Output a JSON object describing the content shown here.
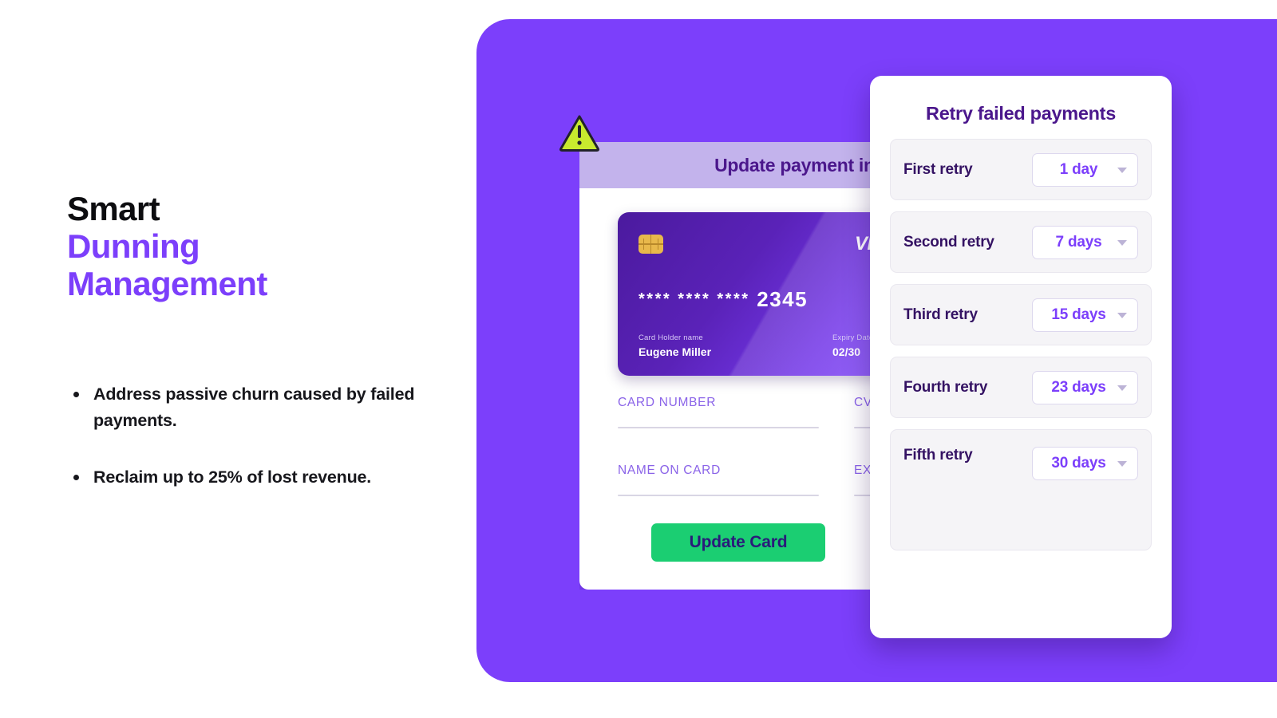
{
  "headline": {
    "line1": "Smart",
    "line2": "Dunning",
    "line3": "Management"
  },
  "bullets": [
    "Address passive churn caused by failed payments.",
    "Reclaim up to 25% of lost revenue."
  ],
  "payment_modal": {
    "title": "Update payment info",
    "warning_icon": "warning-triangle-icon",
    "credit_card": {
      "chip_icon": "chip-icon",
      "brand": "VISA",
      "masked_groups": "**** **** ****",
      "last_four": "2345",
      "holder_label": "Card Holder name",
      "holder_name": "Eugene Miller",
      "expiry_label": "Expiry Date",
      "expiry_value": "02/30"
    },
    "fields": {
      "card_number_label": "CARD NUMBER",
      "cvc_label": "CVC",
      "name_on_card_label": "NAME ON CARD",
      "exp_date_label": "EXP DATE"
    },
    "submit_label": "Update Card"
  },
  "retry_panel": {
    "title": "Retry failed payments",
    "rows": [
      {
        "label": "First retry",
        "value": "1 day"
      },
      {
        "label": "Second retry",
        "value": "7 days"
      },
      {
        "label": "Third retry",
        "value": "15 days"
      },
      {
        "label": "Fourth retry",
        "value": "23 days"
      },
      {
        "label": "Fifth retry",
        "value": "30 days"
      }
    ]
  },
  "colors": {
    "accent_purple": "#7C3FFB",
    "deep_purple": "#4B178C",
    "header_lavender": "#C3B3EC",
    "success_green": "#1BCE72",
    "button_text": "#2A1A7A",
    "warning_yellow": "#C8EA2E",
    "chip_gold": "#E8B84B",
    "row_gray": "#F5F4F7"
  }
}
